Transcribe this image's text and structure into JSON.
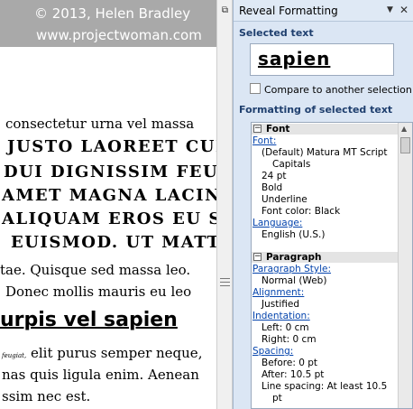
{
  "document": {
    "watermark_line1": "© 2013, Helen Bradley",
    "watermark_line2": "www.projectwoman.com",
    "lines": [
      "consectetur urna vel massa",
      "JUSTO LAOREET CURSUS",
      "DUI DIGNISSIM FEUGIAT",
      "AMET MAGNA LACINIA",
      "ALIQUAM EROS EU SEM",
      "EUISMOD. UT MATTIS",
      "tae. Quisque sed massa leo.",
      "Donec mollis mauris eu leo",
      "urpis vel sapien",
      "elit purus semper neque,",
      "nas quis ligula enim. Aenean",
      "ssim nec est."
    ],
    "tiny_word": "feugiat,"
  },
  "pane": {
    "title": "Reveal Formatting",
    "selected_text_header": "Selected text",
    "selected_text": "sapien",
    "compare_label": "Compare to another selection",
    "formatting_header": "Formatting of selected text",
    "groups": {
      "font": {
        "label": "Font",
        "link": "Font:",
        "items": [
          "(Default) Matura MT Script",
          "Capitals",
          "24 pt",
          "Bold",
          "Underline",
          "Font color: Black"
        ],
        "language_link": "Language:",
        "language_value": "English (U.S.)"
      },
      "paragraph": {
        "label": "Paragraph",
        "style_link": "Paragraph Style:",
        "style_value": "Normal (Web)",
        "alignment_link": "Alignment:",
        "alignment_value": "Justified",
        "indentation_link": "Indentation:",
        "left": "Left:  0 cm",
        "right": "Right:  0 cm",
        "spacing_link": "Spacing:",
        "before": "Before:  0 pt",
        "after": "After:  10.5 pt",
        "line_spacing": "Line spacing:  At least 10.5",
        "line_spacing_cont": "pt"
      }
    }
  }
}
